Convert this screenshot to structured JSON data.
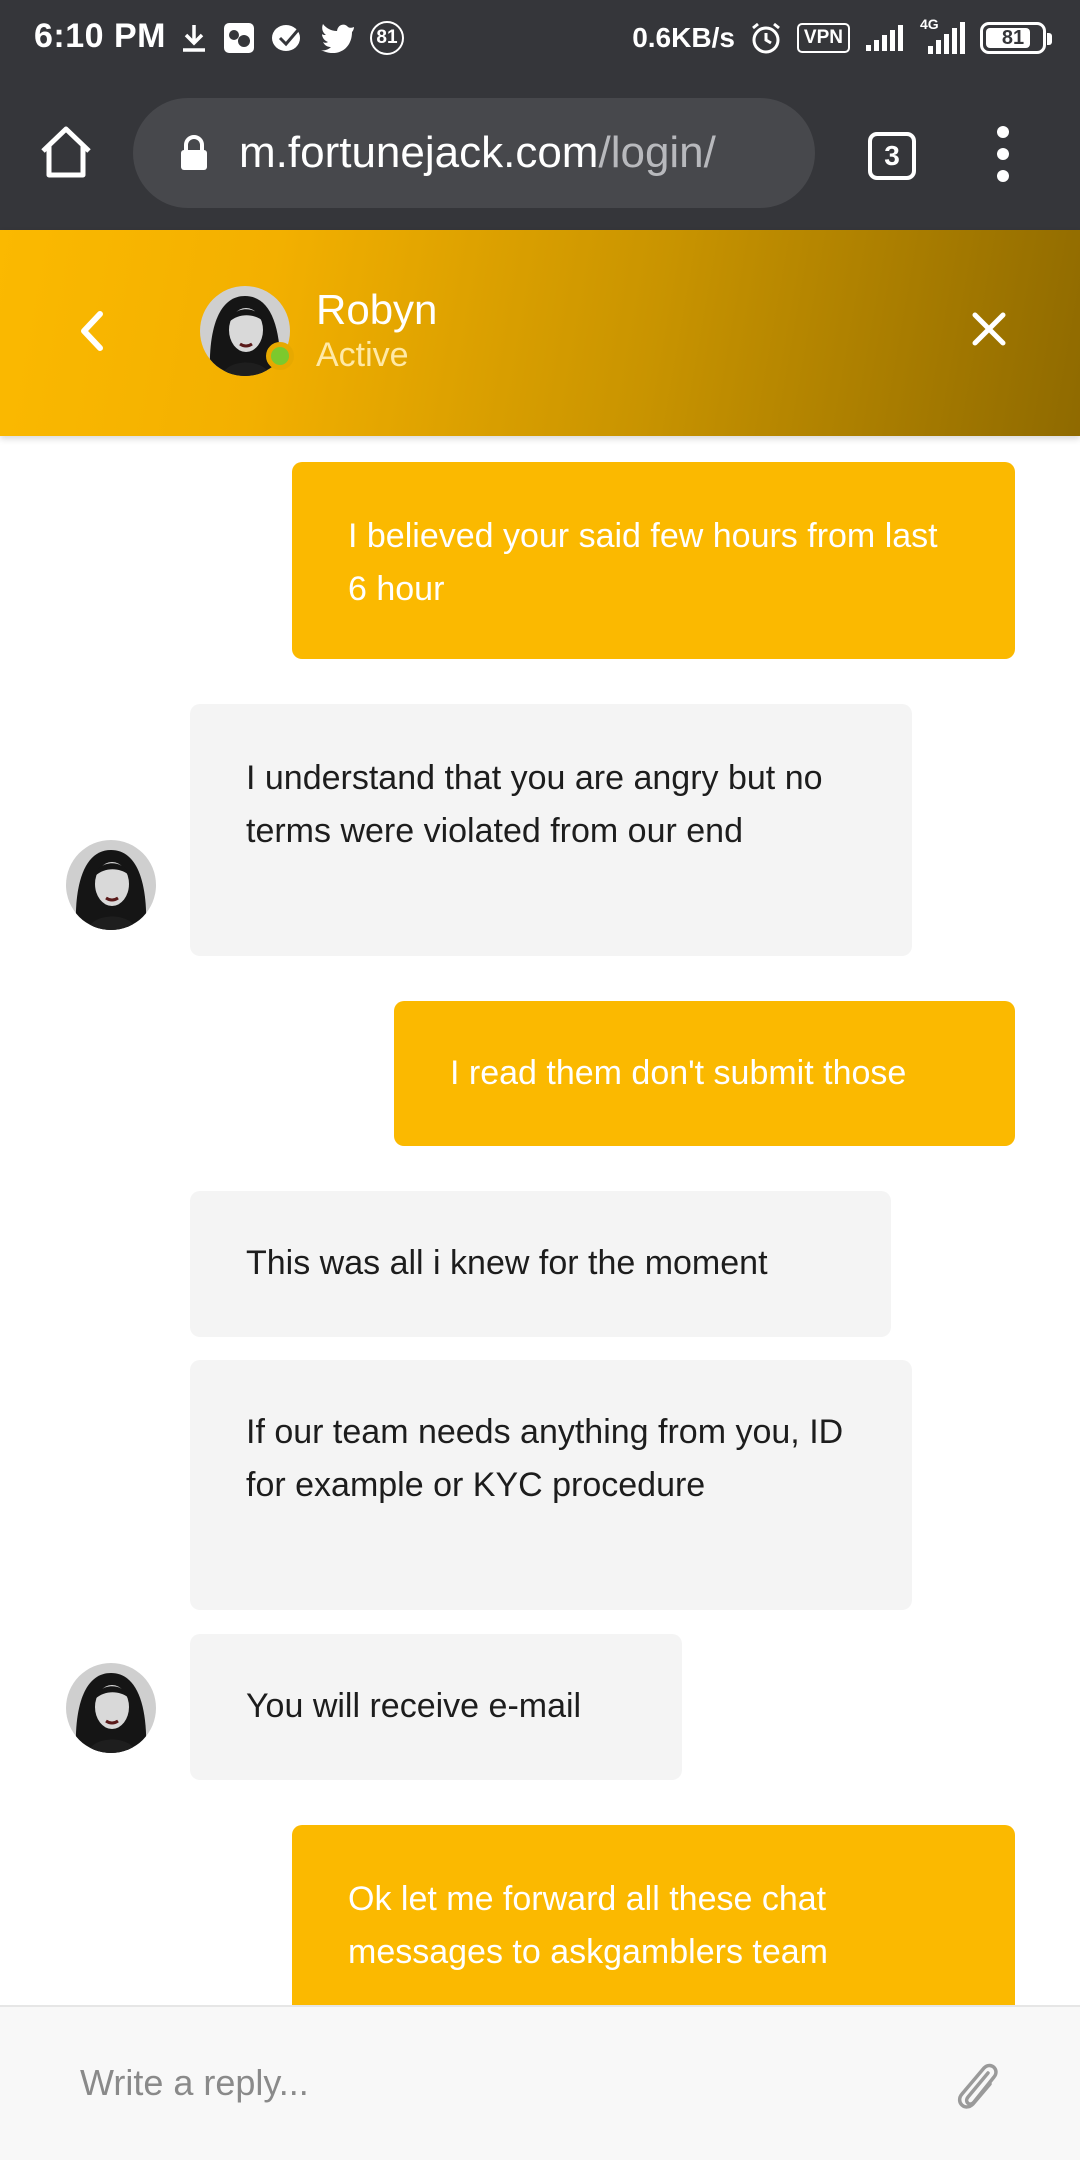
{
  "status_bar": {
    "time": "6:10 PM",
    "notification_count": "81",
    "network_speed": "0.6KB/s",
    "vpn_label": "VPN",
    "network_type": "4G",
    "battery_level": "81",
    "battery_fraction": 0.81,
    "icons": [
      "download-icon",
      "app-icon",
      "app-icon",
      "twitter-icon",
      "alarm-icon",
      "signal-icon",
      "signal-icon"
    ]
  },
  "browser": {
    "url_host": "m.fortunejack.com",
    "url_path": "/login/",
    "tab_count": "3"
  },
  "chat_header": {
    "agent_name": "Robyn",
    "agent_status": "Active",
    "online_color": "#7cc92d",
    "accent_color": "#fbb900"
  },
  "messages": [
    {
      "sender": "user",
      "text": "I believed your said few hours from last 6 hour"
    },
    {
      "sender": "agent",
      "text": "I understand that you are angry but no terms were violated from our end"
    },
    {
      "sender": "user",
      "text": "I read them don't submit those"
    },
    {
      "sender": "agent",
      "text": "This was all i knew for the moment"
    },
    {
      "sender": "agent",
      "text": "If our team needs anything from you, ID for example or KYC procedure"
    },
    {
      "sender": "agent",
      "text": "You will receive e-mail"
    },
    {
      "sender": "user",
      "text": "Ok let me forward all these chat messages to askgamblers team"
    }
  ],
  "reply": {
    "placeholder": "Write a reply..."
  }
}
